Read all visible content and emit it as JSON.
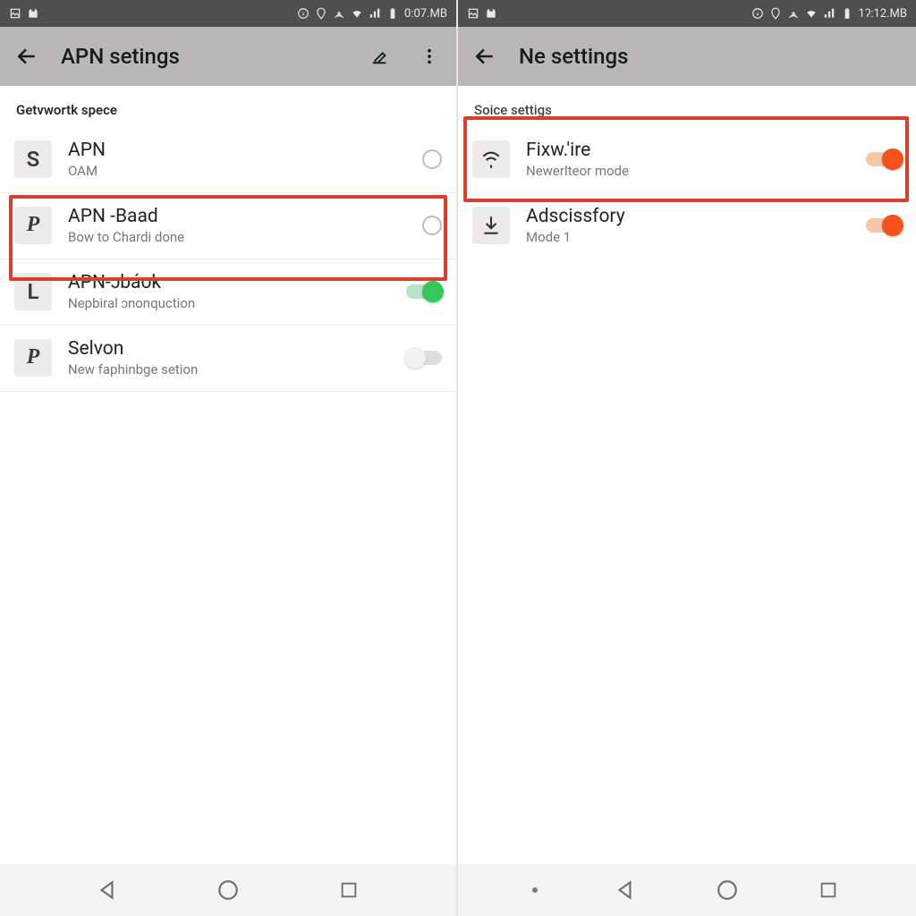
{
  "left": {
    "status_time": "0:07.MB",
    "app_title": "APN setings",
    "section": "Getvwortk spece",
    "items": [
      {
        "icon": "S",
        "title": "APN",
        "sub": "OAM"
      },
      {
        "icon": "P",
        "title": "APN -Baad",
        "sub": "Bow to Chardi done"
      },
      {
        "icon": "L",
        "title": "APN-ɔbáok",
        "sub": "Nepbiral ɔnonquction"
      },
      {
        "icon": "P",
        "title": "Selvon",
        "sub": "New faphinbge setion"
      }
    ]
  },
  "right": {
    "status_time": "1ʔ:12.MB",
    "app_title": "Ne settings",
    "section": "Soice settigs",
    "items": [
      {
        "title": "Fixw.'ire",
        "sub": "Newerlteor mode"
      },
      {
        "title": "Adscissfory",
        "sub": "Mode 1"
      }
    ]
  }
}
